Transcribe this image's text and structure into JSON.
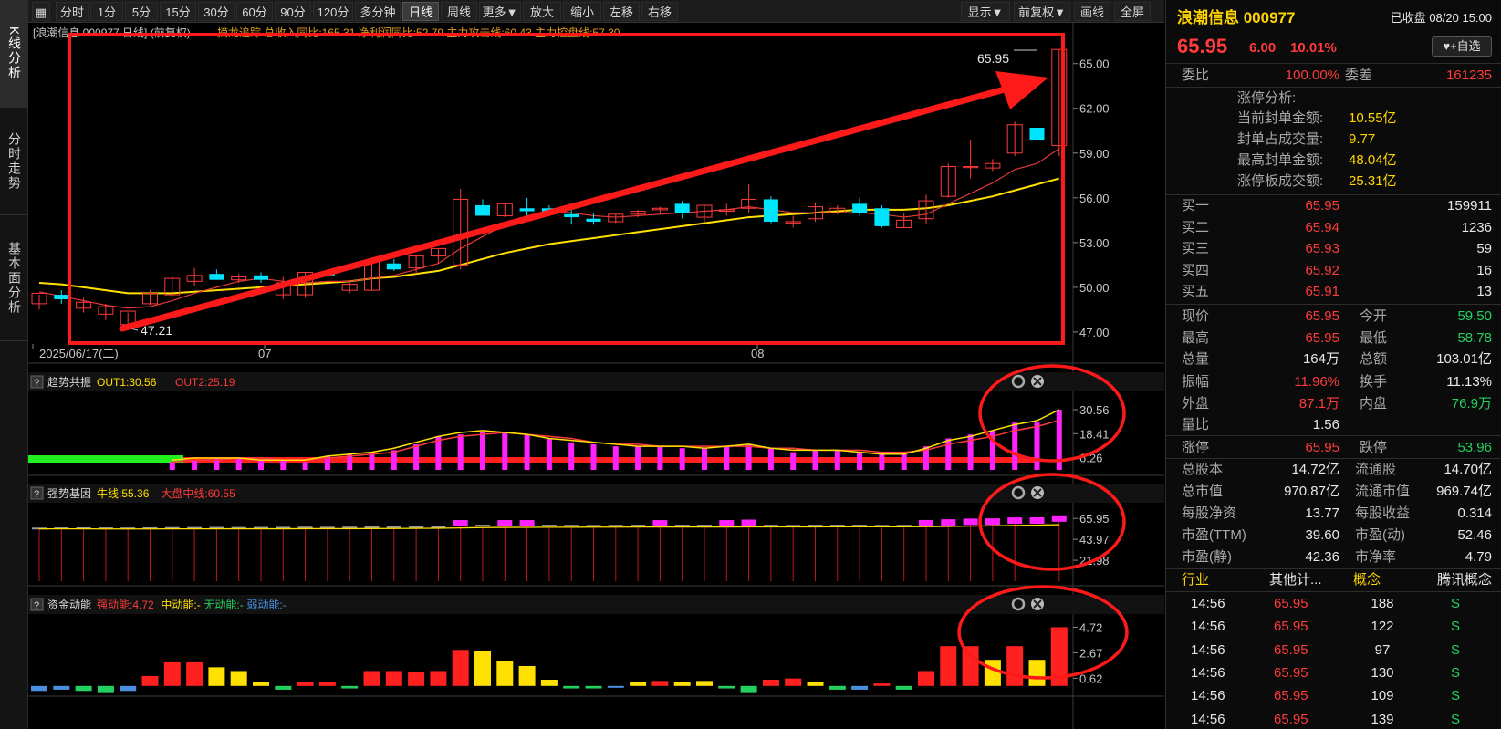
{
  "sidenav": [
    "K线分析",
    "分时走势",
    "基本面分析"
  ],
  "toolbar": {
    "left": [
      "分时",
      "1分",
      "5分",
      "15分",
      "30分",
      "60分",
      "90分",
      "120分",
      "多分钟",
      "日线",
      "周线",
      "更多▼",
      "放大",
      "缩小",
      "左移",
      "右移"
    ],
    "right": [
      "显示▼",
      "前复权▼",
      "画线",
      "全屏"
    ],
    "active": "日线"
  },
  "chart_data": [
    {
      "type": "candlestick",
      "title": "[浪潮信息 000977 日线] (前复权)",
      "legend": "摘龙追踪 总收入同比:165.31 净利润同比:52.79 主力攻击线:60.43 主力控盘线:57.30",
      "x_labels": [
        "2025/06/17(二)",
        "07",
        "08"
      ],
      "y_ticks": [
        "65.00",
        "62.00",
        "59.00",
        "56.00",
        "53.00",
        "50.00",
        "47.00"
      ],
      "ylim": [
        46.2,
        65.9
      ],
      "annotations": [
        "65.95",
        "47.21"
      ],
      "candles": [
        {
          "o": 48.9,
          "h": 49.5,
          "l": 48.5,
          "c": 49.6
        },
        {
          "o": 49.5,
          "h": 49.8,
          "l": 48.9,
          "c": 49.2
        },
        {
          "o": 48.6,
          "h": 49.3,
          "l": 48.3,
          "c": 49.0
        },
        {
          "o": 48.2,
          "h": 48.9,
          "l": 47.8,
          "c": 48.7
        },
        {
          "o": 47.5,
          "h": 48.3,
          "l": 47.21,
          "c": 48.4
        },
        {
          "o": 48.9,
          "h": 49.8,
          "l": 48.8,
          "c": 49.6
        },
        {
          "o": 49.5,
          "h": 50.8,
          "l": 49.3,
          "c": 50.6
        },
        {
          "o": 50.4,
          "h": 51.3,
          "l": 50.1,
          "c": 50.8
        },
        {
          "o": 50.9,
          "h": 51.2,
          "l": 50.6,
          "c": 50.5
        },
        {
          "o": 50.5,
          "h": 50.9,
          "l": 50.3,
          "c": 50.7
        },
        {
          "o": 50.8,
          "h": 51.0,
          "l": 50.3,
          "c": 50.5
        },
        {
          "o": 49.5,
          "h": 50.7,
          "l": 49.2,
          "c": 50.3
        },
        {
          "o": 49.5,
          "h": 51.0,
          "l": 49.3,
          "c": 51.0
        },
        {
          "o": 51.0,
          "h": 51.2,
          "l": 50.7,
          "c": 50.8
        },
        {
          "o": 49.8,
          "h": 50.5,
          "l": 49.6,
          "c": 50.2
        },
        {
          "o": 49.8,
          "h": 52.0,
          "l": 49.8,
          "c": 51.7
        },
        {
          "o": 51.6,
          "h": 51.9,
          "l": 51.1,
          "c": 51.2
        },
        {
          "o": 51.3,
          "h": 52.1,
          "l": 50.9,
          "c": 52.1
        },
        {
          "o": 52.1,
          "h": 52.6,
          "l": 51.6,
          "c": 52.6
        },
        {
          "o": 51.5,
          "h": 56.6,
          "l": 51.2,
          "c": 55.9
        },
        {
          "o": 55.5,
          "h": 55.9,
          "l": 54.8,
          "c": 54.8
        },
        {
          "o": 54.8,
          "h": 55.6,
          "l": 54.7,
          "c": 55.6
        },
        {
          "o": 55.3,
          "h": 56.0,
          "l": 54.7,
          "c": 55.1
        },
        {
          "o": 55.3,
          "h": 55.5,
          "l": 54.8,
          "c": 54.9
        },
        {
          "o": 54.9,
          "h": 55.2,
          "l": 54.2,
          "c": 54.7
        },
        {
          "o": 54.6,
          "h": 55.0,
          "l": 54.2,
          "c": 54.4
        },
        {
          "o": 54.4,
          "h": 54.9,
          "l": 54.3,
          "c": 54.9
        },
        {
          "o": 54.9,
          "h": 55.2,
          "l": 54.7,
          "c": 55.1
        },
        {
          "o": 55.2,
          "h": 55.4,
          "l": 54.9,
          "c": 55.3
        },
        {
          "o": 55.6,
          "h": 55.8,
          "l": 54.6,
          "c": 55.0
        },
        {
          "o": 54.7,
          "h": 55.5,
          "l": 54.4,
          "c": 55.5
        },
        {
          "o": 55.1,
          "h": 55.6,
          "l": 54.8,
          "c": 55.2
        },
        {
          "o": 55.3,
          "h": 56.9,
          "l": 55.0,
          "c": 55.9
        },
        {
          "o": 55.9,
          "h": 56.1,
          "l": 54.3,
          "c": 54.4
        },
        {
          "o": 54.3,
          "h": 54.8,
          "l": 54.0,
          "c": 54.4
        },
        {
          "o": 54.6,
          "h": 55.7,
          "l": 54.4,
          "c": 55.4
        },
        {
          "o": 55.0,
          "h": 55.5,
          "l": 54.9,
          "c": 55.3
        },
        {
          "o": 55.6,
          "h": 56.0,
          "l": 54.8,
          "c": 55.0
        },
        {
          "o": 55.3,
          "h": 55.5,
          "l": 54.0,
          "c": 54.1
        },
        {
          "o": 54.0,
          "h": 55.0,
          "l": 54.0,
          "c": 54.5
        },
        {
          "o": 54.6,
          "h": 56.2,
          "l": 54.2,
          "c": 55.8
        },
        {
          "o": 56.1,
          "h": 58.3,
          "l": 56.0,
          "c": 58.1
        },
        {
          "o": 58.1,
          "h": 59.9,
          "l": 57.3,
          "c": 58.1
        },
        {
          "o": 58.0,
          "h": 58.6,
          "l": 57.8,
          "c": 58.3
        },
        {
          "o": 59.0,
          "h": 61.1,
          "l": 58.8,
          "c": 60.9
        },
        {
          "o": 60.7,
          "h": 60.9,
          "l": 59.6,
          "c": 59.9
        },
        {
          "o": 59.5,
          "h": 65.95,
          "l": 58.78,
          "c": 65.95
        }
      ],
      "ma_short": [
        49.7,
        49.4,
        49.1,
        48.8,
        48.6,
        48.7,
        49.1,
        49.6,
        50.0,
        50.4,
        50.6,
        50.4,
        50.3,
        50.4,
        50.4,
        50.6,
        50.8,
        51.2,
        51.6,
        52.6,
        53.4,
        54.2,
        54.7,
        55.1,
        55.0,
        54.8,
        54.7,
        54.8,
        54.9,
        55.0,
        55.1,
        55.2,
        55.4,
        55.2,
        55.0,
        55.0,
        55.0,
        55.0,
        54.9,
        54.7,
        54.9,
        55.6,
        56.3,
        57.0,
        57.9,
        58.3,
        59.3
      ],
      "ma_long": [
        50.3,
        50.2,
        50.0,
        49.8,
        49.6,
        49.6,
        49.6,
        49.7,
        49.8,
        49.9,
        50.0,
        50.1,
        50.2,
        50.3,
        50.4,
        50.6,
        50.7,
        50.9,
        51.1,
        51.5,
        51.9,
        52.3,
        52.6,
        52.9,
        53.1,
        53.3,
        53.5,
        53.7,
        53.9,
        54.1,
        54.3,
        54.5,
        54.7,
        54.8,
        54.9,
        55.0,
        55.1,
        55.2,
        55.2,
        55.2,
        55.3,
        55.5,
        55.8,
        56.1,
        56.5,
        56.9,
        57.3
      ]
    },
    {
      "type": "bar",
      "title": "趋势共振",
      "legend_items": [
        {
          "text": "OUT1:30.56",
          "color": "#ffe000"
        },
        {
          "text": "OUT2:25.19",
          "color": "#ff3b3b"
        }
      ],
      "y_ticks": [
        "30.56",
        "18.41",
        "6.26"
      ],
      "ylim": [
        0,
        31.5
      ],
      "values": [
        0,
        0,
        0,
        0,
        0,
        0,
        4,
        5,
        6,
        6,
        5,
        5,
        4,
        7,
        8,
        9,
        10,
        13,
        17,
        18,
        19,
        19,
        18,
        16,
        14,
        13,
        12,
        12,
        12,
        11,
        11,
        12,
        13,
        11,
        9,
        10,
        10,
        9,
        8,
        8,
        12,
        16,
        18,
        20,
        24,
        24,
        30.56
      ],
      "out1": [
        0,
        0,
        0,
        0,
        0,
        0,
        5,
        6,
        6,
        6,
        5,
        5,
        5,
        7,
        8,
        9,
        11,
        14,
        17,
        19,
        20,
        19,
        18,
        16,
        15,
        14,
        13,
        12,
        12,
        12,
        11,
        12,
        13,
        11,
        10,
        10,
        10,
        9,
        8,
        8,
        11,
        15,
        17,
        20,
        23,
        25,
        30.56
      ],
      "out2": [
        0,
        0,
        0,
        0,
        0,
        0,
        4,
        5,
        5,
        6,
        6,
        5,
        5,
        6,
        7,
        8,
        9,
        12,
        15,
        17,
        18,
        19,
        18,
        17,
        16,
        14,
        13,
        13,
        12,
        12,
        12,
        12,
        12,
        11,
        11,
        10,
        10,
        10,
        9,
        9,
        10,
        13,
        15,
        17,
        20,
        22,
        25.19
      ]
    },
    {
      "type": "bar",
      "title": "强势基因",
      "legend_items": [
        {
          "text": "牛线:55.36",
          "color": "#ffe000"
        },
        {
          "text": "大盘中线:60.55",
          "color": "#ff3b3b"
        }
      ],
      "y_ticks": [
        "65.95",
        "43.97",
        "21.98"
      ],
      "ylim": [
        0,
        70
      ],
      "values": [
        54.4,
        54.6,
        54.7,
        54.6,
        54.5,
        54.7,
        54.9,
        55.0,
        55.1,
        55.0,
        55.1,
        55.2,
        55.4,
        55.3,
        55.4,
        55.6,
        55.8,
        55.9,
        56.0,
        57.5,
        57.4,
        57.5,
        57.5,
        57.4,
        57.3,
        57.2,
        57.3,
        57.4,
        57.5,
        57.4,
        57.4,
        57.5,
        58.0,
        57.3,
        57.2,
        57.4,
        57.4,
        57.4,
        57.2,
        57.3,
        57.6,
        58.4,
        59.1,
        59.3,
        60.3,
        60.4,
        62.5
      ],
      "line": [
        55.0,
        55.0,
        55.0,
        54.9,
        54.9,
        54.9,
        55.0,
        55.0,
        55.0,
        55.1,
        55.1,
        55.1,
        55.2,
        55.2,
        55.2,
        55.3,
        55.4,
        55.5,
        55.6,
        56.0,
        56.3,
        56.5,
        56.6,
        56.7,
        56.7,
        56.8,
        56.8,
        56.9,
        56.9,
        56.9,
        56.9,
        57.0,
        57.1,
        57.1,
        57.1,
        57.1,
        57.2,
        57.2,
        57.2,
        57.2,
        57.3,
        57.6,
        57.9,
        58.2,
        58.6,
        59.0,
        59.4
      ]
    },
    {
      "type": "bar",
      "title": "资金动能",
      "legend_items": [
        {
          "text": "强动能:4.72",
          "color": "#ff3b3b"
        },
        {
          "text": "中动能:-",
          "color": "#ffe000"
        },
        {
          "text": "无动能:-",
          "color": "#23d160"
        },
        {
          "text": "弱动能:-",
          "color": "#4a8fe0"
        }
      ],
      "y_ticks": [
        "4.72",
        "2.67",
        "0.62"
      ],
      "ylim": [
        -0.6,
        4.9
      ],
      "values": [
        -0.4,
        -0.3,
        -0.4,
        -0.5,
        -0.4,
        0.8,
        1.9,
        1.9,
        1.5,
        1.2,
        0.3,
        -0.3,
        0.3,
        0.3,
        -0.2,
        1.2,
        1.2,
        1.1,
        1.2,
        2.9,
        2.8,
        2.0,
        1.6,
        0.5,
        -0.2,
        -0.2,
        -0.1,
        0.3,
        0.4,
        0.3,
        0.4,
        -0.2,
        -0.5,
        0.5,
        0.6,
        0.3,
        -0.3,
        -0.3,
        0.2,
        -0.3,
        1.2,
        3.2,
        3.2,
        2.1,
        3.2,
        2.1,
        4.72
      ],
      "colors": [
        "#4a8fe0",
        "#4a8fe0",
        "#23d160",
        "#23d160",
        "#4a8fe0",
        "#ff2020",
        "#ff2020",
        "#ff2020",
        "#ffe000",
        "#ffe000",
        "#ffe000",
        "#23d160",
        "#ff2020",
        "#ff2020",
        "#23d160",
        "#ff2020",
        "#ff2020",
        "#ff2020",
        "#ff2020",
        "#ff2020",
        "#ffe000",
        "#ffe000",
        "#ffe000",
        "#ffe000",
        "#23d160",
        "#23d160",
        "#4a8fe0",
        "#ffe000",
        "#ff2020",
        "#ffe000",
        "#ffe000",
        "#23d160",
        "#23d160",
        "#ff2020",
        "#ff2020",
        "#ffe000",
        "#23d160",
        "#4a8fe0",
        "#ff2020",
        "#23d160",
        "#ff2020",
        "#ff2020",
        "#ff2020",
        "#ffe000",
        "#ff2020",
        "#ffe000",
        "#ff2020"
      ]
    }
  ],
  "quote": {
    "name": "浪潮信息 000977",
    "status": "已收盘 08/20 15:00",
    "price": "65.95",
    "change": "6.00",
    "change_pct": "10.01%",
    "watch_btn": "+自选",
    "bid_ratio_label": "委比",
    "bid_ratio": "100.00%",
    "bid_diff_label": "委差",
    "bid_diff": "161235",
    "limit_title": "涨停分析:",
    "limit": [
      {
        "label": "当前封单金额:",
        "value": "10.55亿"
      },
      {
        "label": "封单占成交量:",
        "value": "9.77"
      },
      {
        "label": "最高封单金额:",
        "value": "48.04亿"
      },
      {
        "label": "涨停板成交额:",
        "value": "25.31亿"
      }
    ],
    "bids": [
      {
        "label": "买一",
        "price": "65.95",
        "vol": "159911"
      },
      {
        "label": "买二",
        "price": "65.94",
        "vol": "1236"
      },
      {
        "label": "买三",
        "price": "65.93",
        "vol": "59"
      },
      {
        "label": "买四",
        "price": "65.92",
        "vol": "16"
      },
      {
        "label": "买五",
        "price": "65.91",
        "vol": "13"
      }
    ],
    "stats": [
      {
        "l1": "现价",
        "v1": "65.95",
        "c1": "red",
        "l2": "今开",
        "v2": "59.50",
        "c2": "green"
      },
      {
        "l1": "最高",
        "v1": "65.95",
        "c1": "red",
        "l2": "最低",
        "v2": "58.78",
        "c2": "green"
      },
      {
        "l1": "总量",
        "v1": "164万",
        "c1": "white",
        "l2": "总额",
        "v2": "103.01亿",
        "c2": "white"
      }
    ],
    "stats2": [
      {
        "l1": "振幅",
        "v1": "11.96%",
        "c1": "red",
        "l2": "换手",
        "v2": "11.13%",
        "c2": "white"
      },
      {
        "l1": "外盘",
        "v1": "87.1万",
        "c1": "red",
        "l2": "内盘",
        "v2": "76.9万",
        "c2": "green"
      },
      {
        "l1": "量比",
        "v1": "1.56",
        "c1": "white",
        "l2": "",
        "v2": "",
        "c2": "white"
      }
    ],
    "limits": {
      "up_label": "涨停",
      "up": "65.95",
      "down_label": "跌停",
      "down": "53.96"
    },
    "fund": [
      {
        "l1": "总股本",
        "v1": "14.72亿",
        "l2": "流通股",
        "v2": "14.70亿"
      },
      {
        "l1": "总市值",
        "v1": "970.87亿",
        "l2": "流通市值",
        "v2": "969.74亿"
      },
      {
        "l1": "每股净资",
        "v1": "13.77",
        "l2": "每股收益",
        "v2": "0.314"
      },
      {
        "l1": "市盈(TTM)",
        "v1": "39.60",
        "l2": "市盈(动)",
        "v2": "52.46"
      },
      {
        "l1": "市盈(静)",
        "v1": "42.36",
        "l2": "市净率",
        "v2": "4.79"
      }
    ],
    "industry": {
      "l1": "行业",
      "v1": "其他计...",
      "l2": "概念",
      "v2": "腾讯概念"
    },
    "ticks": [
      {
        "t": "14:56",
        "p": "65.95",
        "v": "188",
        "s": "S"
      },
      {
        "t": "14:56",
        "p": "65.95",
        "v": "122",
        "s": "S"
      },
      {
        "t": "14:56",
        "p": "65.95",
        "v": "97",
        "s": "S"
      },
      {
        "t": "14:56",
        "p": "65.95",
        "v": "130",
        "s": "S"
      },
      {
        "t": "14:56",
        "p": "65.95",
        "v": "109",
        "s": "S"
      },
      {
        "t": "14:56",
        "p": "65.95",
        "v": "139",
        "s": "S"
      }
    ]
  }
}
